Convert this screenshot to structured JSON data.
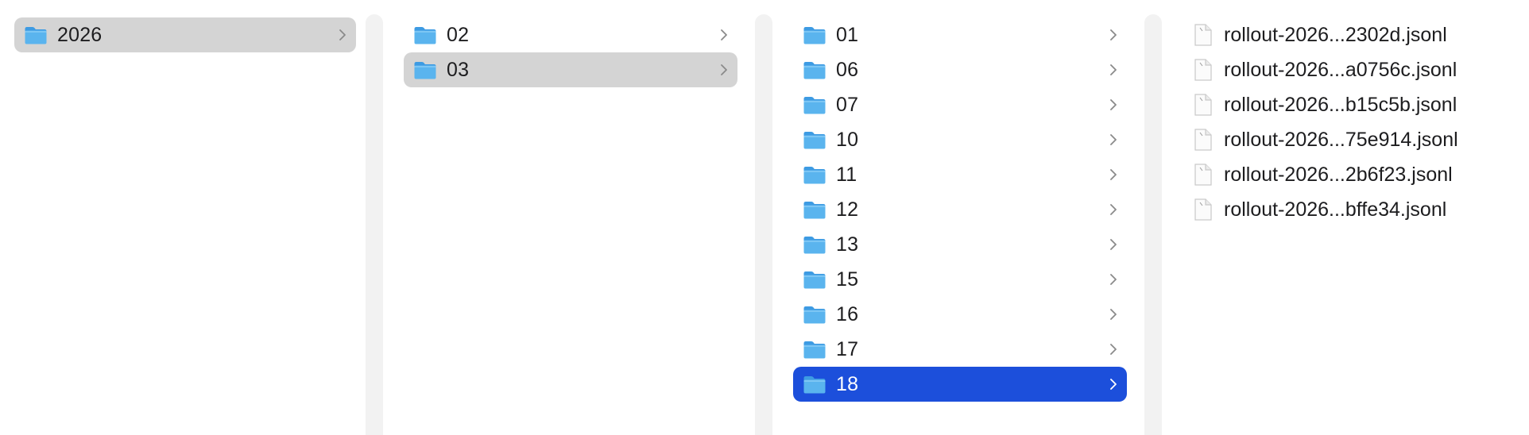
{
  "columns": {
    "col1": {
      "items": [
        {
          "label": "2026",
          "type": "folder",
          "state": "selected-inactive"
        }
      ]
    },
    "col2": {
      "items": [
        {
          "label": "02",
          "type": "folder",
          "state": "normal"
        },
        {
          "label": "03",
          "type": "folder",
          "state": "selected-inactive"
        }
      ]
    },
    "col3": {
      "items": [
        {
          "label": "01",
          "type": "folder",
          "state": "normal"
        },
        {
          "label": "06",
          "type": "folder",
          "state": "normal"
        },
        {
          "label": "07",
          "type": "folder",
          "state": "normal"
        },
        {
          "label": "10",
          "type": "folder",
          "state": "normal"
        },
        {
          "label": "11",
          "type": "folder",
          "state": "normal"
        },
        {
          "label": "12",
          "type": "folder",
          "state": "normal"
        },
        {
          "label": "13",
          "type": "folder",
          "state": "normal"
        },
        {
          "label": "15",
          "type": "folder",
          "state": "normal"
        },
        {
          "label": "16",
          "type": "folder",
          "state": "normal"
        },
        {
          "label": "17",
          "type": "folder",
          "state": "normal"
        },
        {
          "label": "18",
          "type": "folder",
          "state": "selected-active"
        }
      ]
    },
    "col4": {
      "items": [
        {
          "label": "rollout-2026...2302d.jsonl",
          "type": "file"
        },
        {
          "label": "rollout-2026...a0756c.jsonl",
          "type": "file"
        },
        {
          "label": "rollout-2026...b15c5b.jsonl",
          "type": "file"
        },
        {
          "label": "rollout-2026...75e914.jsonl",
          "type": "file"
        },
        {
          "label": "rollout-2026...2b6f23.jsonl",
          "type": "file"
        },
        {
          "label": "rollout-2026...bffe34.jsonl",
          "type": "file"
        }
      ]
    }
  },
  "icons": {
    "folder": "folder-icon",
    "file": "document-icon",
    "chevron": "chevron-right-icon"
  },
  "colors": {
    "selection_active": "#1c4fdb",
    "selection_inactive": "#d4d4d4",
    "folder_blue": "#5ab4ee",
    "divider": "#f2f2f2"
  }
}
